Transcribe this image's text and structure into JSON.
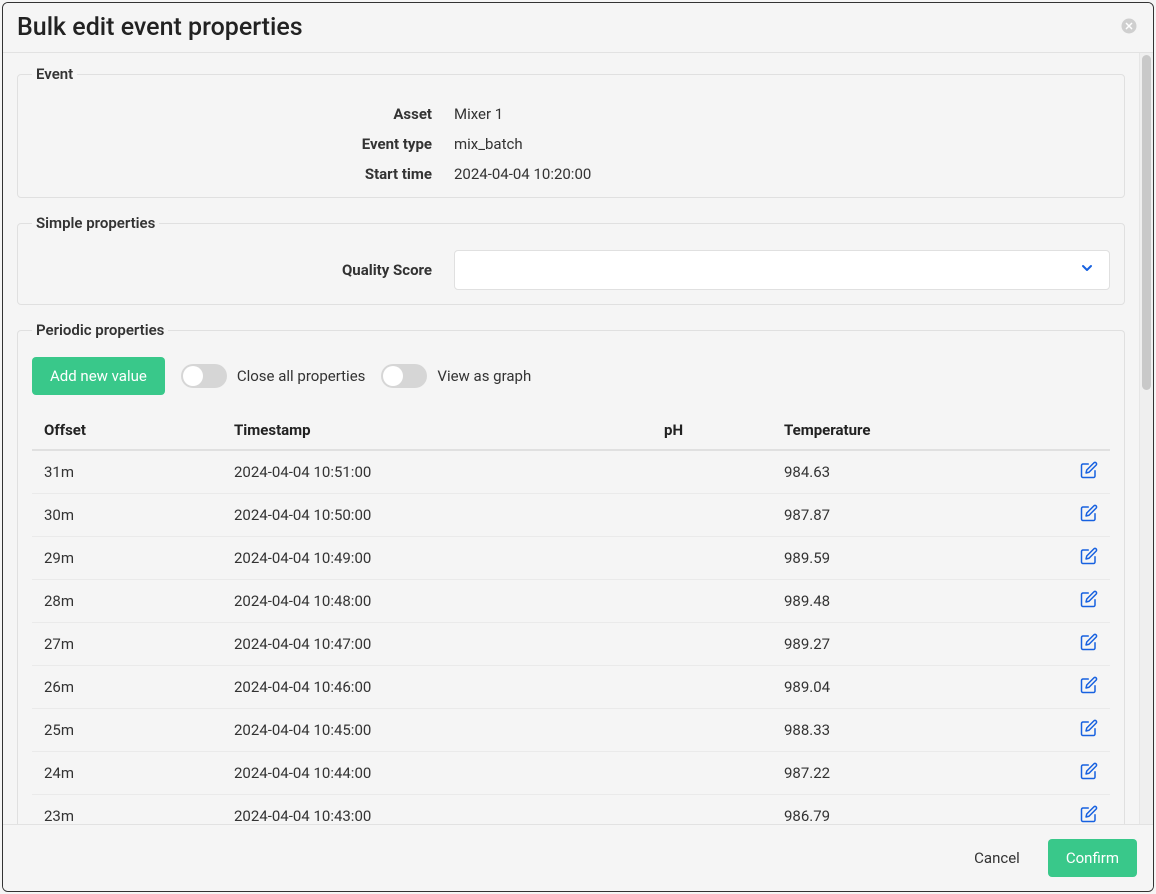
{
  "modal": {
    "title": "Bulk edit event properties"
  },
  "event": {
    "legend": "Event",
    "asset_label": "Asset",
    "asset_value": "Mixer 1",
    "type_label": "Event type",
    "type_value": "mix_batch",
    "start_label": "Start time",
    "start_value": "2024-04-04 10:20:00"
  },
  "simple": {
    "legend": "Simple properties",
    "quality_label": "Quality Score",
    "quality_value": ""
  },
  "periodic": {
    "legend": "Periodic properties",
    "add_btn": "Add new value",
    "close_all_label": "Close all properties",
    "view_graph_label": "View as graph"
  },
  "columns": {
    "offset": "Offset",
    "timestamp": "Timestamp",
    "ph": "pH",
    "temperature": "Temperature"
  },
  "rows": [
    {
      "offset": "31m",
      "timestamp": "2024-04-04 10:51:00",
      "ph": "",
      "temperature": "984.63"
    },
    {
      "offset": "30m",
      "timestamp": "2024-04-04 10:50:00",
      "ph": "",
      "temperature": "987.87"
    },
    {
      "offset": "29m",
      "timestamp": "2024-04-04 10:49:00",
      "ph": "",
      "temperature": "989.59"
    },
    {
      "offset": "28m",
      "timestamp": "2024-04-04 10:48:00",
      "ph": "",
      "temperature": "989.48"
    },
    {
      "offset": "27m",
      "timestamp": "2024-04-04 10:47:00",
      "ph": "",
      "temperature": "989.27"
    },
    {
      "offset": "26m",
      "timestamp": "2024-04-04 10:46:00",
      "ph": "",
      "temperature": "989.04"
    },
    {
      "offset": "25m",
      "timestamp": "2024-04-04 10:45:00",
      "ph": "",
      "temperature": "988.33"
    },
    {
      "offset": "24m",
      "timestamp": "2024-04-04 10:44:00",
      "ph": "",
      "temperature": "987.22"
    },
    {
      "offset": "23m",
      "timestamp": "2024-04-04 10:43:00",
      "ph": "",
      "temperature": "986.79"
    }
  ],
  "footer": {
    "cancel": "Cancel",
    "confirm": "Confirm"
  }
}
